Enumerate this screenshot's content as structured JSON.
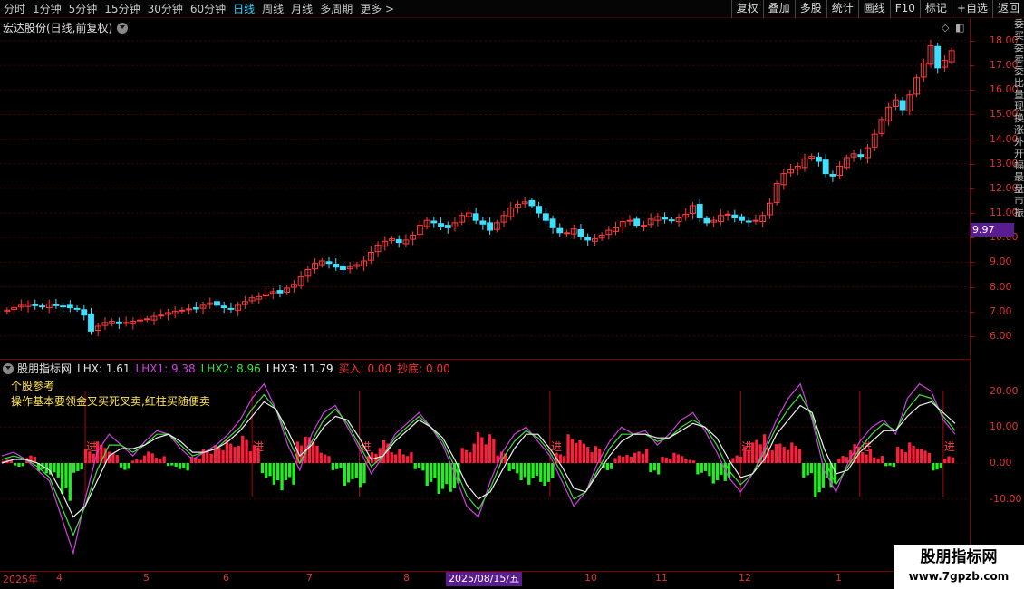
{
  "toolbar": {
    "periods": [
      {
        "label": "分时",
        "active": false
      },
      {
        "label": "1分钟",
        "active": false
      },
      {
        "label": "5分钟",
        "active": false
      },
      {
        "label": "15分钟",
        "active": false
      },
      {
        "label": "30分钟",
        "active": false
      },
      {
        "label": "60分钟",
        "active": false
      },
      {
        "label": "日线",
        "active": true
      },
      {
        "label": "周线",
        "active": false
      },
      {
        "label": "月线",
        "active": false
      },
      {
        "label": "多周期",
        "active": false
      },
      {
        "label": "更多 >",
        "active": false
      }
    ],
    "tools": [
      "复权",
      "叠加",
      "多股",
      "统计",
      "画线",
      "F10",
      "标记",
      "+自选",
      "返回"
    ]
  },
  "chart_header": {
    "title": "宏达股份(日线,前复权)"
  },
  "price_axis": {
    "ticks": [
      "18.00",
      "17.00",
      "16.00",
      "15.00",
      "14.00",
      "13.00",
      "12.00",
      "11.00",
      "10.00",
      "9.00",
      "8.00",
      "7.00",
      "6.00"
    ],
    "current_price_label": "9.97"
  },
  "side_column": {
    "text": "委买委卖委比量现换涨外开幅最盘市振"
  },
  "indicator": {
    "name": "股朋指标网",
    "values": [
      {
        "label": "LHX: 1.61",
        "color": "#e0e0e0"
      },
      {
        "label": "LHX1: 9.38",
        "color": "#d040e0"
      },
      {
        "label": "LHX2: 8.96",
        "color": "#40e040"
      },
      {
        "label": "LHX3: 11.79",
        "color": "#f0f0f0"
      },
      {
        "label": "买入: 0.00",
        "color": "#ff3030"
      },
      {
        "label": "抄底: 0.00",
        "color": "#ff3030"
      }
    ],
    "notes": [
      "个股参考",
      "操作基本要领金叉买死叉卖,红柱买随便卖"
    ],
    "axis_ticks": [
      "20.00",
      "10.00",
      "0.00",
      "-10.00"
    ],
    "signal_label": "进"
  },
  "date_axis": {
    "labels": [
      "2025年",
      "4",
      "5",
      "6",
      "7",
      "8",
      "9",
      "10",
      "11",
      "12",
      "1"
    ],
    "selected": "2025/08/15/五"
  },
  "watermark": {
    "line1": "股朋指标网",
    "line2": "www.7gpzb.com"
  },
  "colors": {
    "up": "#ff3b3b",
    "down": "#3ee0ff",
    "ma_main": "#ffffff",
    "lhx1": "#d040e0",
    "lhx2": "#40e040",
    "axis": "#7a0000",
    "accent": "#5a1d91"
  },
  "chart_data": [
    {
      "type": "candlestick",
      "title": "宏达股份(日线,前复权)",
      "ylim": [
        5.5,
        18.5
      ],
      "close": [
        7.05,
        7.15,
        7.25,
        7.3,
        7.25,
        7.2,
        7.3,
        7.25,
        7.2,
        7.15,
        7.1,
        6.85,
        6.2,
        6.4,
        6.55,
        6.6,
        6.5,
        6.55,
        6.6,
        6.65,
        6.7,
        6.8,
        6.85,
        6.95,
        7.0,
        7.05,
        7.1,
        7.1,
        7.25,
        7.35,
        7.25,
        7.15,
        7.1,
        7.25,
        7.4,
        7.55,
        7.6,
        7.7,
        7.8,
        7.75,
        7.95,
        8.1,
        8.4,
        8.7,
        8.95,
        9.05,
        8.95,
        8.8,
        8.7,
        8.8,
        8.9,
        9.05,
        9.4,
        9.7,
        9.85,
        9.95,
        9.8,
        9.9,
        10.1,
        10.5,
        10.7,
        10.6,
        10.45,
        10.4,
        10.6,
        10.9,
        11.0,
        10.7,
        10.55,
        10.3,
        10.6,
        10.9,
        11.2,
        11.35,
        11.45,
        11.3,
        11.0,
        10.7,
        10.4,
        10.2,
        10.2,
        10.35,
        10.05,
        9.9,
        9.95,
        10.1,
        10.3,
        10.4,
        10.65,
        10.7,
        10.5,
        10.5,
        10.75,
        10.85,
        10.75,
        10.7,
        10.8,
        10.95,
        11.3,
        10.8,
        10.6,
        10.7,
        10.9,
        10.95,
        10.8,
        10.7,
        10.65,
        10.7,
        10.9,
        11.4,
        12.2,
        12.6,
        12.75,
        12.9,
        13.2,
        13.3,
        13.1,
        12.6,
        12.5,
        12.9,
        13.25,
        13.4,
        13.3,
        13.65,
        14.2,
        14.8,
        15.3,
        15.6,
        15.2,
        15.8,
        16.5,
        17.1,
        17.8,
        16.9,
        17.2,
        17.6
      ],
      "legend": "none"
    },
    {
      "type": "line+bar",
      "title": "股朋指标网",
      "ylim": [
        -20,
        25
      ],
      "series": [
        {
          "name": "LHX1",
          "values": [
            2,
            3,
            1,
            -2,
            -5,
            -15,
            -25,
            -10,
            3,
            8,
            5,
            2,
            6,
            9,
            8,
            4,
            1,
            3,
            5,
            8,
            12,
            18,
            22,
            15,
            5,
            -2,
            8,
            14,
            16,
            10,
            4,
            -3,
            2,
            8,
            11,
            14,
            10,
            5,
            -3,
            -12,
            -15,
            -5,
            3,
            8,
            10,
            6,
            2,
            -5,
            -12,
            -8,
            0,
            6,
            10,
            8,
            9,
            5,
            8,
            12,
            14,
            9,
            3,
            -4,
            -8,
            -3,
            4,
            12,
            18,
            22,
            12,
            -2,
            -8,
            0,
            6,
            10,
            12,
            8,
            18,
            22,
            20,
            12,
            8
          ],
          "color": "#d040e0"
        },
        {
          "name": "LHX2",
          "values": [
            1,
            2,
            1,
            -1,
            -4,
            -12,
            -20,
            -12,
            -2,
            5,
            5,
            3,
            5,
            8,
            8,
            5,
            2,
            3,
            4,
            7,
            10,
            15,
            19,
            15,
            7,
            0,
            6,
            12,
            15,
            11,
            5,
            -1,
            2,
            7,
            10,
            13,
            10,
            6,
            -1,
            -9,
            -13,
            -7,
            1,
            6,
            9,
            7,
            3,
            -3,
            -10,
            -8,
            -2,
            4,
            8,
            8,
            8,
            6,
            7,
            10,
            12,
            10,
            5,
            -2,
            -6,
            -3,
            3,
            10,
            15,
            19,
            13,
            1,
            -6,
            -1,
            4,
            8,
            11,
            9,
            15,
            19,
            18,
            13,
            9
          ],
          "color": "#40e040"
        },
        {
          "name": "LHX3",
          "values": [
            0,
            1,
            1,
            0,
            -2,
            -8,
            -15,
            -12,
            -5,
            2,
            4,
            4,
            5,
            7,
            8,
            6,
            3,
            3,
            4,
            6,
            9,
            13,
            17,
            15,
            9,
            2,
            5,
            10,
            13,
            12,
            7,
            1,
            2,
            6,
            9,
            12,
            10,
            7,
            1,
            -6,
            -10,
            -8,
            -2,
            4,
            8,
            8,
            4,
            -1,
            -7,
            -8,
            -3,
            2,
            6,
            8,
            8,
            7,
            7,
            9,
            11,
            10,
            7,
            1,
            -4,
            -3,
            1,
            8,
            12,
            16,
            14,
            4,
            -3,
            -2,
            3,
            6,
            9,
            9,
            13,
            16,
            17,
            14,
            11
          ],
          "color": "#f0f0f0"
        },
        {
          "name": "LHX",
          "values": [
            1,
            -1,
            2,
            -3,
            -4,
            -10,
            -3,
            4,
            6,
            3,
            -2,
            1,
            3,
            2,
            -1,
            -2,
            2,
            4,
            5,
            6,
            8,
            5,
            -4,
            -8,
            -6,
            7,
            8,
            3,
            -2,
            -6,
            -7,
            3,
            6,
            4,
            3,
            -2,
            -7,
            -9,
            -8,
            4,
            9,
            8,
            3,
            -3,
            -6,
            -5,
            -7,
            3,
            8,
            6,
            5,
            -2,
            2,
            3,
            4,
            -3,
            2,
            3,
            1,
            -3,
            -6,
            -5,
            2,
            6,
            8,
            5,
            6,
            6,
            -4,
            -9,
            -7,
            2,
            5,
            4,
            2,
            -1,
            5,
            6,
            4,
            -2,
            2
          ],
          "color": "#ff3050"
        }
      ]
    }
  ]
}
